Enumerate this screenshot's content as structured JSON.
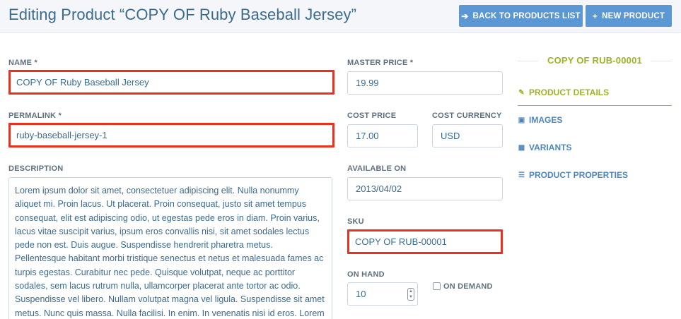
{
  "header": {
    "title": "Editing Product “COPY OF Ruby Baseball Jersey”",
    "back_button": "BACK TO PRODUCTS LIST",
    "new_button": "NEW PRODUCT"
  },
  "form": {
    "name": {
      "label": "NAME *",
      "value": "COPY OF Ruby Baseball Jersey"
    },
    "permalink": {
      "label": "PERMALINK *",
      "value": "ruby-baseball-jersey-1"
    },
    "description": {
      "label": "DESCRIPTION",
      "value": "Lorem ipsum dolor sit amet, consectetuer adipiscing elit. Nulla nonummy aliquet mi. Proin lacus. Ut placerat. Proin consequat, justo sit amet tempus consequat, elit est adipiscing odio, ut egestas pede eros in diam. Proin varius, lacus vitae suscipit varius, ipsum eros convallis nisi, sit amet sodales lectus pede non est. Duis augue. Suspendisse hendrerit pharetra metus. Pellentesque habitant morbi tristique senectus et netus et malesuada fames ac turpis egestas. Curabitur nec pede. Quisque volutpat, neque ac porttitor sodales, sem lacus rutrum nulla, ullamcorper placerat ante tortor ac odio. Suspendisse vel libero. Nullam volutpat magna vel ligula. Suspendisse sit amet metus. Nunc quis massa. Nulla facilisi. In enim. In venenatis nisi id eros. Lorem"
    },
    "master_price": {
      "label": "MASTER PRICE *",
      "value": "19.99"
    },
    "cost_price": {
      "label": "COST PRICE",
      "value": "17.00"
    },
    "cost_currency": {
      "label": "COST CURRENCY",
      "value": "USD"
    },
    "available_on": {
      "label": "AVAILABLE ON",
      "value": "2013/04/02"
    },
    "sku": {
      "label": "SKU",
      "value": "COPY OF RUB-00001"
    },
    "on_hand": {
      "label": "ON HAND",
      "value": "10"
    },
    "on_demand": {
      "label": "ON DEMAND",
      "checked": false
    }
  },
  "sidebar": {
    "title": "COPY OF RUB-00001",
    "items": [
      {
        "label": "PRODUCT DETAILS",
        "icon": "edit-icon",
        "active": true
      },
      {
        "label": "IMAGES",
        "icon": "picture-icon",
        "active": false
      },
      {
        "label": "VARIANTS",
        "icon": "grid-icon",
        "active": false
      },
      {
        "label": "PRODUCT PROPERTIES",
        "icon": "list-icon",
        "active": false
      }
    ]
  },
  "colors": {
    "accent": "#5b97d2",
    "title": "#3b6a8f",
    "active": "#9fb226",
    "highlight": "#e8321e"
  }
}
